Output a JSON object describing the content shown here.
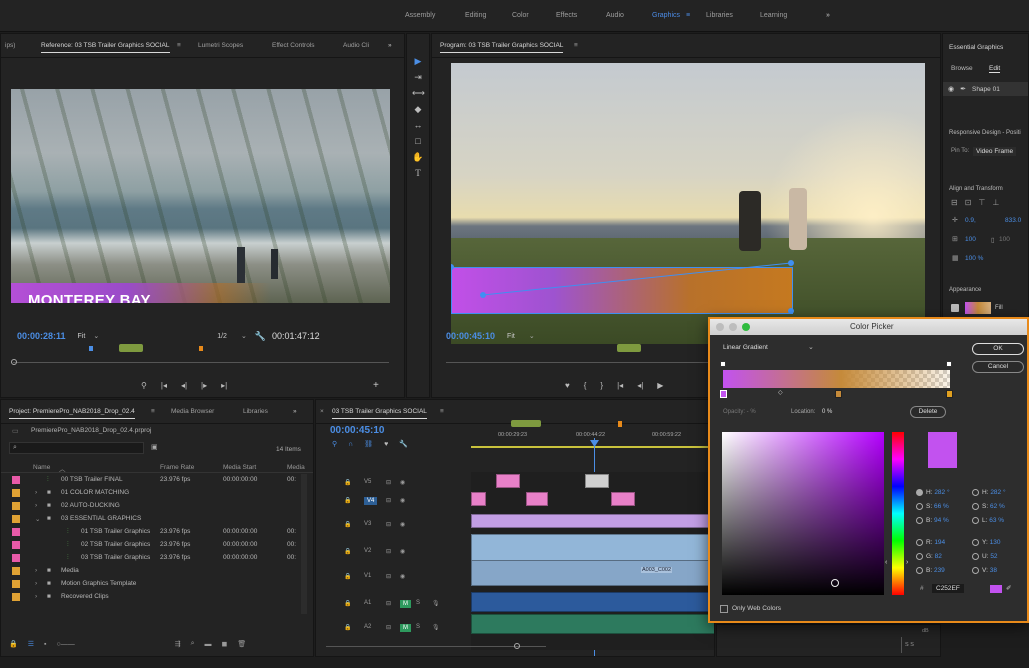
{
  "workspaces": [
    "Assembly",
    "Editing",
    "Color",
    "Effects",
    "Audio",
    "Graphics",
    "Libraries",
    "Learning"
  ],
  "workspace_active": "Graphics",
  "workspace_more": "»",
  "source_panel": {
    "tab_prefix": "ips)",
    "tabs": [
      "Reference: 03 TSB Trailer Graphics SOCIAL",
      "Lumetri Scopes",
      "Effect Controls",
      "Audio Cli"
    ],
    "menu_icon": "≡",
    "more": "»",
    "overlay_title": "MONTEREY BAY",
    "timecode": "00:00:28:11",
    "fit": "Fit",
    "resolution": "1/2",
    "duration": "00:01:47:12"
  },
  "program_panel": {
    "title": "Program: 03 TSB Trailer Graphics SOCIAL",
    "timecode": "00:00:45:10",
    "fit": "Fit"
  },
  "essential_graphics": {
    "title": "Essential Graphics",
    "tabs": [
      "Browse",
      "Edit"
    ],
    "active_tab": "Edit",
    "layer": "Shape 01",
    "responsive_title": "Responsive Design - Positi",
    "pin_to_label": "Pin To:",
    "pin_to_value": "Video Frame",
    "align_title": "Align and Transform",
    "pos_x": "0.9,",
    "pos_y": "833.0",
    "scale_a": "100",
    "scale_b": "100",
    "opacity": "100 %",
    "appearance_title": "Appearance",
    "fill_label": "Fill"
  },
  "project_panel": {
    "tabs": [
      "Project: PremierePro_NAB2018_Drop_02.4",
      "Media Browser",
      "Libraries"
    ],
    "project_file": "PremierePro_NAB2018_Drop_02.4.prproj",
    "item_count": "14 Items",
    "columns": [
      "Name",
      "Frame Rate",
      "Media Start",
      "Media"
    ],
    "rows": [
      {
        "indent": 0,
        "type": "seq",
        "name": "00 TSB Trailer FINAL",
        "fps": "23.976 fps",
        "start": "00:00:00:00",
        "media": "00:",
        "color": "#e85aa8"
      },
      {
        "indent": 0,
        "type": "bin",
        "name": "01 COLOR MATCHING",
        "fps": "",
        "start": "",
        "media": "",
        "color": "#e0a234"
      },
      {
        "indent": 0,
        "type": "bin",
        "name": "02 AUTO-DUCKING",
        "fps": "",
        "start": "",
        "media": "",
        "color": "#e0a234"
      },
      {
        "indent": 0,
        "type": "bin",
        "name": "03 ESSENTIAL GRAPHICS",
        "fps": "",
        "start": "",
        "media": "",
        "color": "#e0a234"
      },
      {
        "indent": 1,
        "type": "seq",
        "name": "01 TSB Trailer Graphics",
        "fps": "23.976 fps",
        "start": "00:00:00:00",
        "media": "00:",
        "color": "#e85aa8"
      },
      {
        "indent": 1,
        "type": "seq",
        "name": "02 TSB Trailer Graphics",
        "fps": "23.976 fps",
        "start": "00:00:00:00",
        "media": "00:",
        "color": "#e85aa8"
      },
      {
        "indent": 1,
        "type": "seq",
        "name": "03 TSB Trailer Graphics",
        "fps": "23.976 fps",
        "start": "00:00:00:00",
        "media": "00:",
        "color": "#e85aa8"
      },
      {
        "indent": 0,
        "type": "bin",
        "name": "Media",
        "fps": "",
        "start": "",
        "media": "",
        "color": "#e0a234"
      },
      {
        "indent": 0,
        "type": "bin",
        "name": "Motion Graphics Template",
        "fps": "",
        "start": "",
        "media": "",
        "color": "#e0a234"
      },
      {
        "indent": 0,
        "type": "bin",
        "name": "Recovered Clips",
        "fps": "",
        "start": "",
        "media": "",
        "color": "#e0a234"
      }
    ]
  },
  "timeline": {
    "title": "03 TSB Trailer Graphics SOCIAL",
    "timecode": "00:00:45:10",
    "ruler": [
      "00:00:29:23",
      "00:00:44:22",
      "00:00:59:22"
    ],
    "tracks": [
      "V5",
      "V4",
      "V3",
      "V2",
      "V1",
      "A1",
      "A2"
    ],
    "clip_label": "A003_C002"
  },
  "color_picker": {
    "title": "Color Picker",
    "mode": "Linear Gradient",
    "ok": "OK",
    "cancel": "Cancel",
    "opacity_label": "Opacity: - %",
    "location_label": "Location:",
    "location_value": "0 %",
    "delete": "Delete",
    "hsb": [
      {
        "k": "H:",
        "v": "282 °"
      },
      {
        "k": "S:",
        "v": "66 %"
      },
      {
        "k": "B:",
        "v": "94 %"
      }
    ],
    "hsl": [
      {
        "k": "H:",
        "v": "282 °"
      },
      {
        "k": "S:",
        "v": "62 %"
      },
      {
        "k": "L:",
        "v": "63 %"
      }
    ],
    "rgb": [
      {
        "k": "R:",
        "v": "194"
      },
      {
        "k": "G:",
        "v": "82"
      },
      {
        "k": "B:",
        "v": "239"
      }
    ],
    "yuv": [
      {
        "k": "Y:",
        "v": "130"
      },
      {
        "k": "U:",
        "v": "52"
      },
      {
        "k": "V:",
        "v": "38"
      }
    ],
    "hex_label": "#",
    "hex": "C252EF",
    "only_web": "Only Web Colors",
    "selected_color": "#c252ef"
  },
  "audio_meter": {
    "db_label": "dB",
    "solo": "S S"
  },
  "colors": {
    "accent": "#4b8ee5",
    "orange": "#e88a1a",
    "purple": "#c252ef"
  }
}
